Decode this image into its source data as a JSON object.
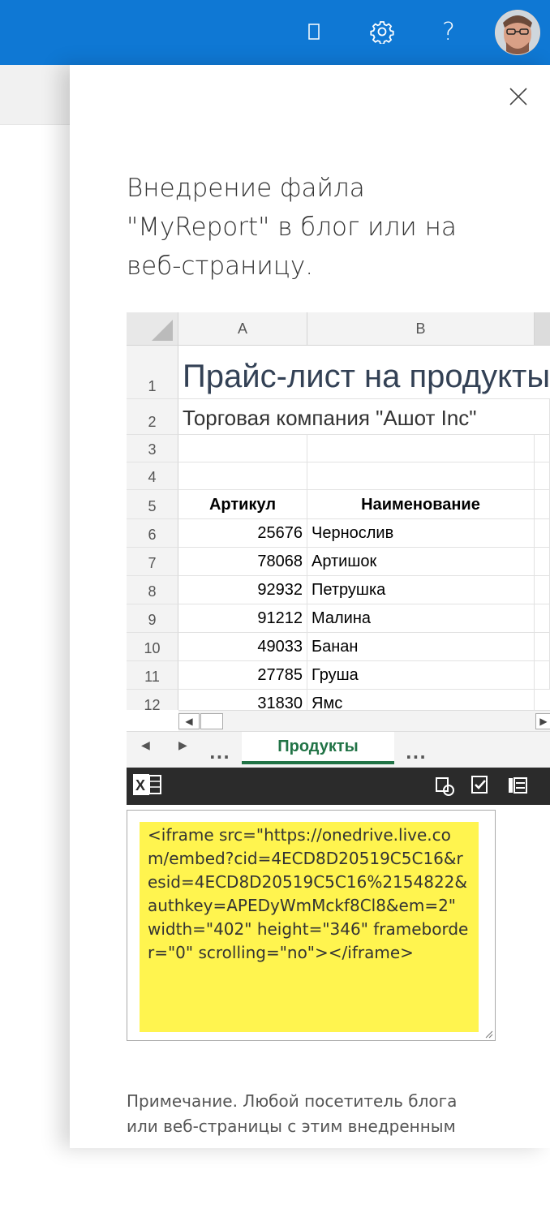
{
  "topbar": {
    "icons": [
      "notification-icon",
      "gear-icon",
      "help-icon",
      "avatar"
    ],
    "help_label": "?"
  },
  "dialog": {
    "heading": "Внедрение файла \"MyReport\" в блог или на веб-страницу.",
    "close_icon": "close-icon"
  },
  "excel": {
    "columns": [
      "A",
      "B"
    ],
    "rows": [
      {
        "num": "1",
        "title": "Прайс-лист на продукты"
      },
      {
        "num": "2",
        "subtitle": "Торговая компания \"Ашот Inc\""
      },
      {
        "num": "3"
      },
      {
        "num": "4"
      },
      {
        "num": "5",
        "a": "Артикул",
        "b": "Наименование"
      },
      {
        "num": "6",
        "a": "25676",
        "b": "Чернослив"
      },
      {
        "num": "7",
        "a": "78068",
        "b": "Артишок"
      },
      {
        "num": "8",
        "a": "92932",
        "b": "Петрушка"
      },
      {
        "num": "9",
        "a": "91212",
        "b": "Малина"
      },
      {
        "num": "10",
        "a": "49033",
        "b": "Банан"
      },
      {
        "num": "11",
        "a": "27785",
        "b": "Груша"
      },
      {
        "num": "12",
        "a": "31830",
        "b": "Ямс"
      }
    ],
    "sheet_tab": "Продукты",
    "tab_more": "..."
  },
  "embed_code": "<iframe src=\"https://onedrive.live.com/embed?cid=4ECD8D20519C5C16&resid=4ECD8D20519C5C16%2154822&authkey=APEDyWmMckf8Cl8&em=2\" width=\"402\" height=\"346\" frameborder=\"0\" scrolling=\"no\"></iframe>",
  "note": "Примечание. Любой посетитель блога или веб-страницы с этим внедренным"
}
